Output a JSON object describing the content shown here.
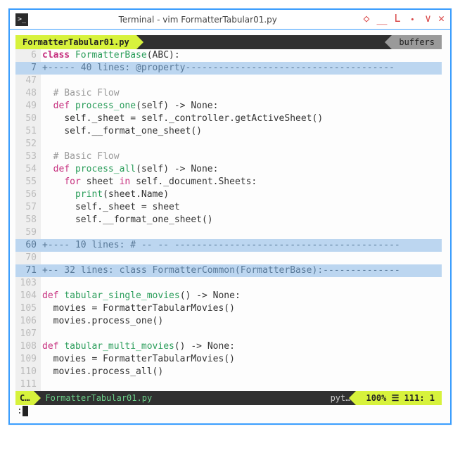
{
  "window": {
    "title": "Terminal - vim FormatterTabular01.py",
    "controls": {
      "c1": "◇",
      "c2": "＿",
      "c3": "𝖫",
      "c4": "・",
      "c5": "∨",
      "c6": "✕"
    }
  },
  "tabline": {
    "active": "FormatterTabular01.py",
    "right": "buffers"
  },
  "lines": [
    {
      "num": "6",
      "kind": "code",
      "html": "<span class='kw-class'>class</span> <span class='fn-name'>FormatterBase</span><span class='text'>(ABC):</span>"
    },
    {
      "num": "7",
      "kind": "fold",
      "html": "+----- 40 lines: @property--------------------------------------"
    },
    {
      "num": "47",
      "kind": "code",
      "html": ""
    },
    {
      "num": "48",
      "kind": "code",
      "html": "  <span class='comment'># Basic Flow</span>"
    },
    {
      "num": "49",
      "kind": "code",
      "html": "  <span class='kw-def'>def</span> <span class='fn-name'>process_one</span><span class='text'>(self) -&gt; None:</span>"
    },
    {
      "num": "50",
      "kind": "code",
      "html": "    <span class='text'>self._sheet = self._controller.getActiveSheet()</span>"
    },
    {
      "num": "51",
      "kind": "code",
      "html": "    <span class='text'>self.__format_one_sheet()</span>"
    },
    {
      "num": "52",
      "kind": "code",
      "html": ""
    },
    {
      "num": "53",
      "kind": "code",
      "html": "  <span class='comment'># Basic Flow</span>"
    },
    {
      "num": "54",
      "kind": "code",
      "html": "  <span class='kw-def'>def</span> <span class='fn-name'>process_all</span><span class='text'>(self) -&gt; None:</span>"
    },
    {
      "num": "55",
      "kind": "code",
      "html": "    <span class='kw-for'>for</span><span class='text'> sheet </span><span class='kw-in'>in</span><span class='text'> self._document.Sheets:</span>"
    },
    {
      "num": "56",
      "kind": "code",
      "html": "      <span class='builtin'>print</span><span class='text'>(sheet.Name)</span>"
    },
    {
      "num": "57",
      "kind": "code",
      "html": "      <span class='text'>self._sheet = sheet</span>"
    },
    {
      "num": "58",
      "kind": "code",
      "html": "      <span class='text'>self.__format_one_sheet()</span>"
    },
    {
      "num": "59",
      "kind": "code",
      "html": ""
    },
    {
      "num": "60",
      "kind": "fold",
      "html": "+---- 10 lines: # -- -- -----------------------------------------"
    },
    {
      "num": "70",
      "kind": "code",
      "html": ""
    },
    {
      "num": "71",
      "kind": "fold",
      "html": "+-- 32 lines: class FormatterCommon(FormatterBase):--------------"
    },
    {
      "num": "103",
      "kind": "code",
      "html": ""
    },
    {
      "num": "104",
      "kind": "code",
      "html": "<span class='kw-def'>def</span> <span class='fn-name'>tabular_single_movies</span><span class='text'>() -&gt; None:</span>"
    },
    {
      "num": "105",
      "kind": "code",
      "html": "  <span class='text'>movies = FormatterTabularMovies()</span>"
    },
    {
      "num": "106",
      "kind": "code",
      "html": "  <span class='text'>movies.process_one()</span>"
    },
    {
      "num": "107",
      "kind": "code",
      "html": ""
    },
    {
      "num": "108",
      "kind": "code",
      "html": "<span class='kw-def'>def</span> <span class='fn-name'>tabular_multi_movies</span><span class='text'>() -&gt; None:</span>"
    },
    {
      "num": "109",
      "kind": "code",
      "html": "  <span class='text'>movies = FormatterTabularMovies()</span>"
    },
    {
      "num": "110",
      "kind": "code",
      "html": "  <span class='text'>movies.process_all()</span>"
    },
    {
      "num": "111",
      "kind": "code",
      "html": ""
    }
  ],
  "statusline": {
    "mode": "C…",
    "file": "FormatterTabular01.py",
    "filetype": "pyt…",
    "percent": "100%",
    "sep": "☰",
    "line": "111",
    "col": "1"
  },
  "cmdline": {
    "prompt": ":"
  }
}
